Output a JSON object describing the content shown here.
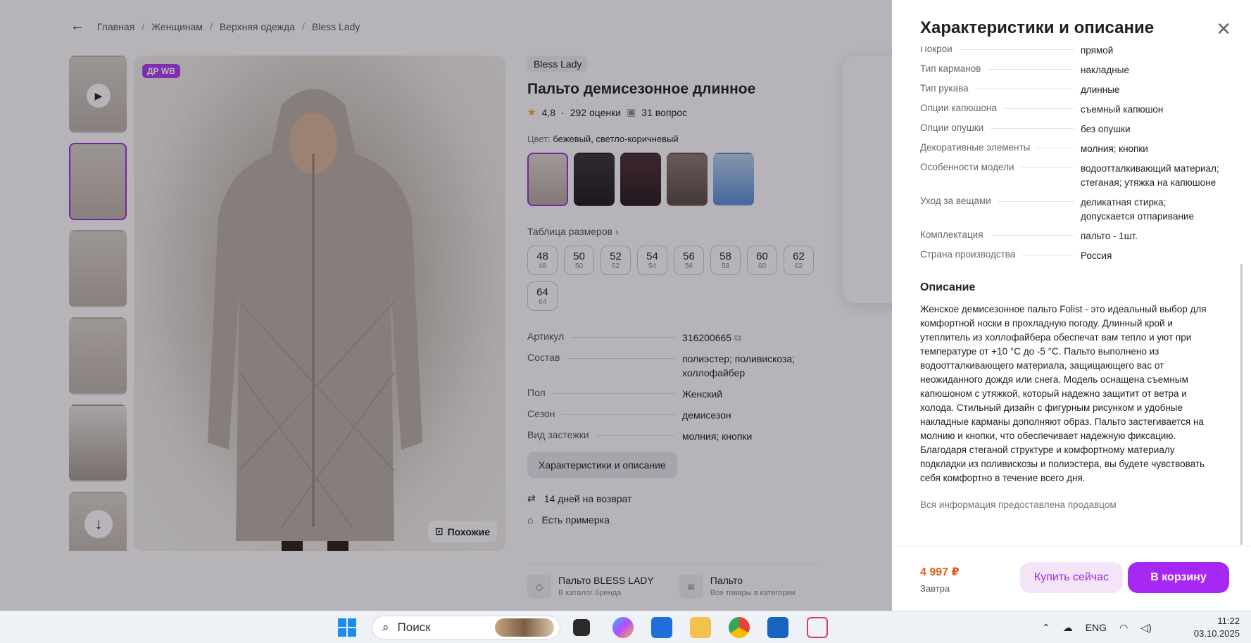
{
  "breadcrumb": {
    "items": [
      "Главная",
      "Женщинам",
      "Верхняя одежда",
      "Bless Lady"
    ],
    "sep": "/"
  },
  "gallery": {
    "badge": "ДР WB",
    "similar_label": "Похожие"
  },
  "product": {
    "brand": "Bless Lady",
    "title": "Пальто демисезонное длинное",
    "rating": "4,8",
    "reviews": "292 оценки",
    "questions": "31 вопрос",
    "color_prefix": "Цвет:",
    "color_value": "бежевый, светло-коричневый",
    "size_table_link": "Таблица размеров",
    "sizes": [
      {
        "n": "48",
        "s": "48"
      },
      {
        "n": "50",
        "s": "50"
      },
      {
        "n": "52",
        "s": "52"
      },
      {
        "n": "54",
        "s": "54"
      },
      {
        "n": "56",
        "s": "56"
      },
      {
        "n": "58",
        "s": "58"
      },
      {
        "n": "60",
        "s": "60"
      },
      {
        "n": "62",
        "s": "62"
      },
      {
        "n": "64",
        "s": "64"
      }
    ],
    "specs": [
      {
        "k": "Артикул",
        "v": "316200665"
      },
      {
        "k": "Состав",
        "v": "полиэстер; поливискоза; холлофайбер"
      },
      {
        "k": "Пол",
        "v": "Женский"
      },
      {
        "k": "Сезон",
        "v": "демисезон"
      },
      {
        "k": "Вид застежки",
        "v": "молния; кнопки"
      }
    ],
    "char_button": "Характеристики и описание",
    "return_text": "14 дней на возврат",
    "fitting_text": "Есть примерка",
    "brand_card_title": "Пальто BLESS LADY",
    "brand_card_sub": "В каталог бренда",
    "cat_card_title": "Пальто",
    "cat_card_sub": "Все товары в категории"
  },
  "drawer": {
    "title": "Характеристики и описание",
    "specs": [
      {
        "k": "Покрой",
        "v": "прямой"
      },
      {
        "k": "Тип карманов",
        "v": "накладные"
      },
      {
        "k": "Тип рукава",
        "v": "длинные"
      },
      {
        "k": "Опции капюшона",
        "v": "съемный капюшон"
      },
      {
        "k": "Опции опушки",
        "v": "без опушки"
      },
      {
        "k": "Декоративные элементы",
        "v": "молния; кнопки"
      },
      {
        "k": "Особенности модели",
        "v": "водоотталкивающий материал; стеганая; утяжка на капюшоне"
      },
      {
        "k": "Уход за вещами",
        "v": "деликатная стирка; допускается отпаривание"
      },
      {
        "k": "Комплектация",
        "v": "пальто - 1шт."
      },
      {
        "k": "Страна производства",
        "v": "Россия"
      }
    ],
    "description_title": "Описание",
    "description": "Женское демисезонное пальто Folist - это идеальный выбор для комфортной носки в прохладную погоду. Длинный крой и утеплитель из холлофайбера обеспечат вам тепло и уют при температуре от +10 °C до -5 °C. Пальто выполнено из водоотталкивающего материала, защищающего вас от неожиданного дождя или снега. Модель оснащена съемным капюшоном с утяжкой, который надежно защитит от ветра и холода. Стильный дизайн с фигурным рисунком и удобные накладные карманы дополняют образ. Пальто застегивается на молнию и кнопки, что обеспечивает надежную фиксацию. Благодаря стеганой структуре и комфортному материалу подкладки из поливискозы и полиэстера, вы будете чувствовать себя комфортно в течение всего дня.",
    "note": "Вся информация предоставлена продавцом",
    "price": "4 997 ₽",
    "delivery": "Завтра",
    "buy_now": "Купить сейчас",
    "to_cart": "В корзину"
  },
  "taskbar": {
    "search_label": "Поиск",
    "lang": "ENG",
    "time": "11:22",
    "date": "03.10.2025"
  },
  "colors": {
    "accent": "#a628f2",
    "price": "#e25a1c"
  }
}
